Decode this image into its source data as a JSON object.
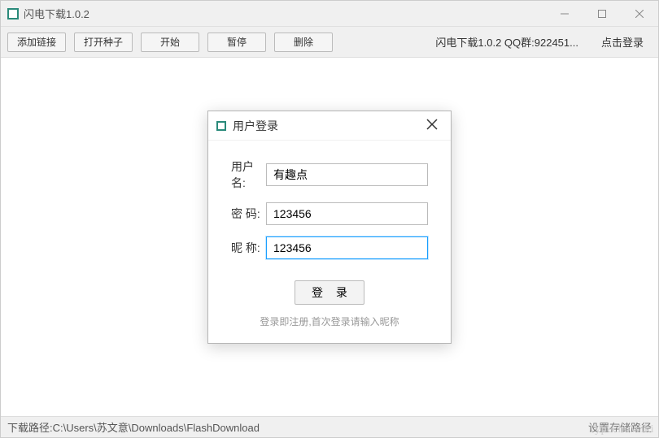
{
  "titlebar": {
    "title": "闪电下载1.0.2"
  },
  "toolbar": {
    "add_link": "添加链接",
    "open_torrent": "打开种子",
    "start": "开始",
    "pause": "暂停",
    "delete": "删除",
    "info": "闪电下载1.0.2   QQ群:922451...",
    "login_link": "点击登录"
  },
  "dialog": {
    "title": "用户登录",
    "labels": {
      "username": "用户名:",
      "password": "密  码:",
      "nickname": "昵  称:"
    },
    "values": {
      "username": "有趣点",
      "password": "123456",
      "nickname": "123456"
    },
    "login_button": "登 录",
    "hint": "登录即注册,首次登录请输入昵称"
  },
  "statusbar": {
    "path": "下载路径:C:\\Users\\苏文意\\Downloads\\FlashDownload",
    "right": "设置存储路径"
  },
  "watermark": "TypechoWiki"
}
